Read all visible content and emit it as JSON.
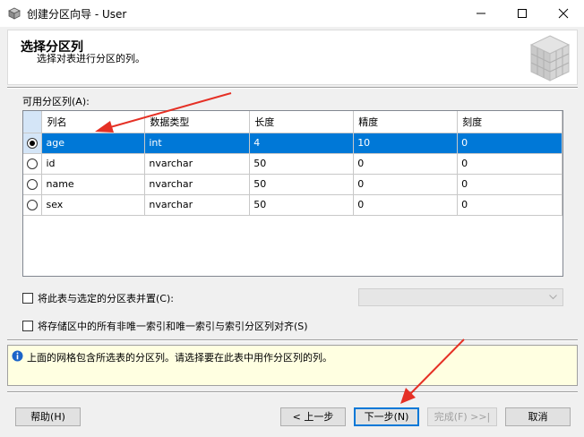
{
  "window": {
    "title": "创建分区向导 - User"
  },
  "header": {
    "title": "选择分区列",
    "subtitle": "选择对表进行分区的列。"
  },
  "section": {
    "label": "可用分区列(A):"
  },
  "grid": {
    "columns": [
      "列名",
      "数据类型",
      "长度",
      "精度",
      "刻度"
    ],
    "rows": [
      {
        "name": "age",
        "type": "int",
        "length": "4",
        "precision": "10",
        "scale": "0",
        "selected": true
      },
      {
        "name": "id",
        "type": "nvarchar",
        "length": "50",
        "precision": "0",
        "scale": "0",
        "selected": false
      },
      {
        "name": "name",
        "type": "nvarchar",
        "length": "50",
        "precision": "0",
        "scale": "0",
        "selected": false
      },
      {
        "name": "sex",
        "type": "nvarchar",
        "length": "50",
        "precision": "0",
        "scale": "0",
        "selected": false
      }
    ]
  },
  "options": {
    "colocate_label": "将此表与选定的分区表并置(C):",
    "align_label": "将存储区中的所有非唯一索引和唯一索引与索引分区列对齐(S)"
  },
  "info": {
    "text": "上面的网格包含所选表的分区列。请选择要在此表中用作分区列的列。"
  },
  "buttons": {
    "help": "帮助(H)",
    "back": "< 上一步",
    "next": "下一步(N)",
    "finish": "完成(F) >>|",
    "cancel": "取消"
  },
  "colors": {
    "selection": "#0078d7",
    "annotation": "#e53025",
    "info_bg": "#ffffe1"
  },
  "icons": [
    "app-icon",
    "cube-icon",
    "info-icon",
    "radio-icon",
    "chevron-down-icon"
  ]
}
